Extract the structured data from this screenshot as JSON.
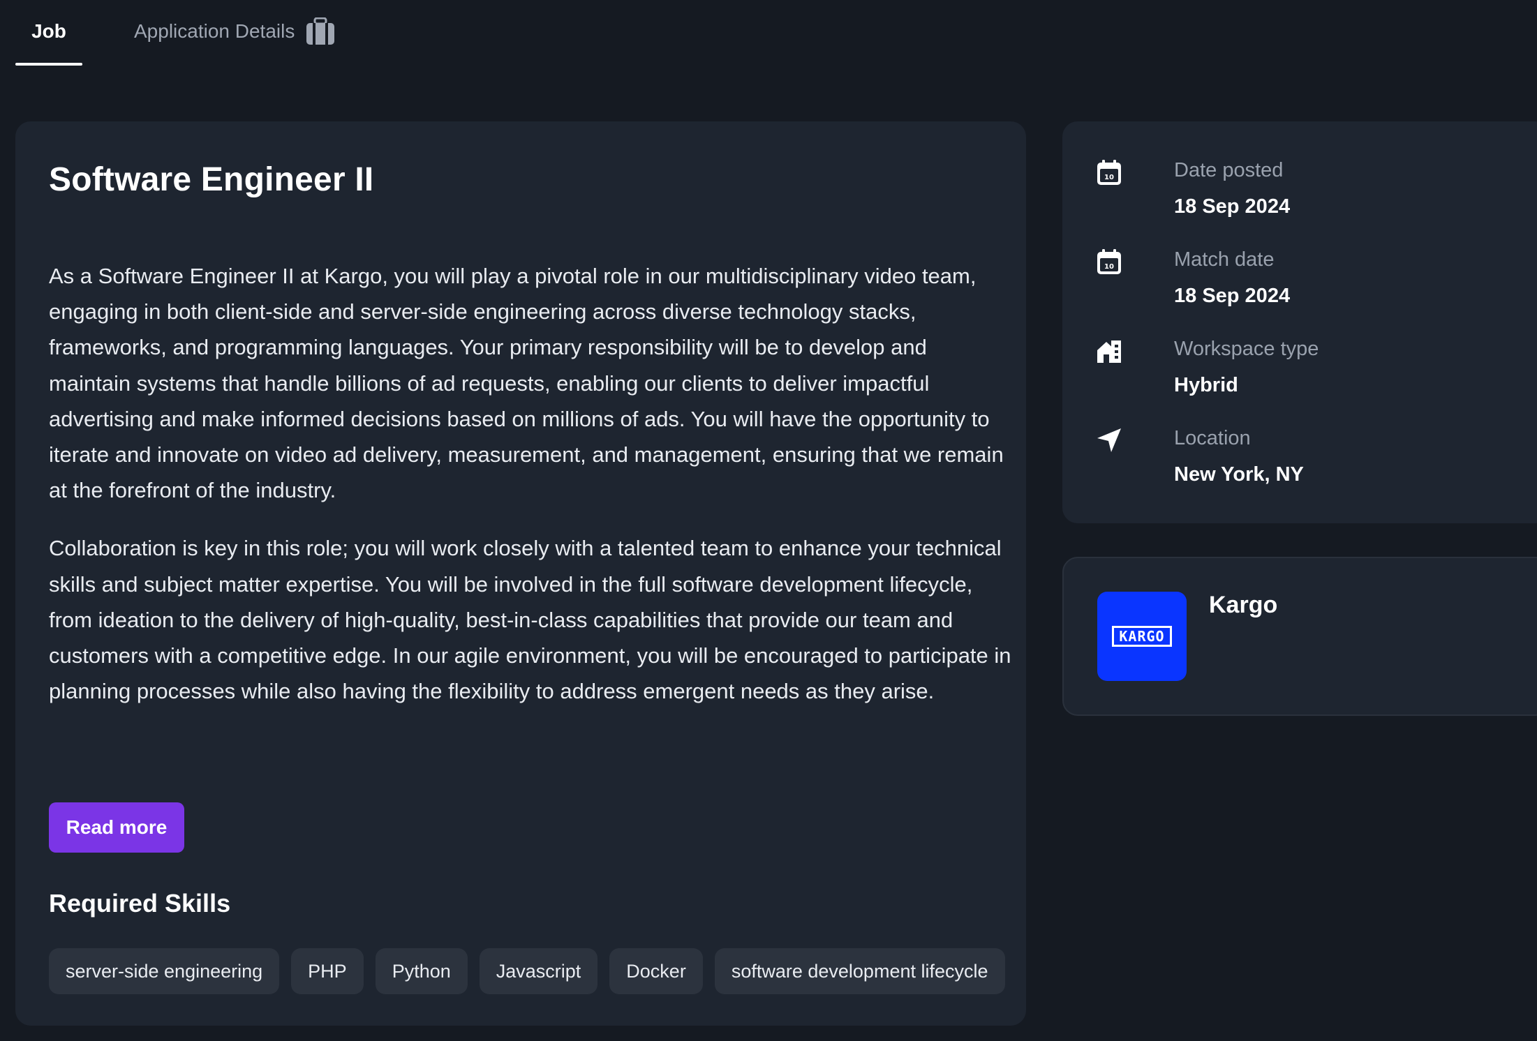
{
  "tabs": [
    {
      "label": "Job",
      "active": true
    },
    {
      "label": "Application Details",
      "icon": "briefcase-icon",
      "active": false
    }
  ],
  "job": {
    "title": "Software Engineer II",
    "description": [
      "As a Software Engineer II at Kargo, you will play a pivotal role in our multidisciplinary video team, engaging in both client-side and server-side engineering across diverse technology stacks, frameworks, and programming languages. Your primary responsibility will be to develop and maintain systems that handle billions of ad requests, enabling our clients to deliver impactful advertising and make informed decisions based on millions of ads. You will have the opportunity to iterate and innovate on video ad delivery, measurement, and management, ensuring that we remain at the forefront of the industry.",
      "Collaboration is key in this role; you will work closely with a talented team to enhance your technical skills and subject matter expertise. You will be involved in the full software development lifecycle, from ideation to the delivery of high-quality, best-in-class capabilities that provide our team and customers with a competitive edge. In our agile environment, you will be encouraged to participate in planning processes while also having the flexibility to address emergent needs as they arise."
    ],
    "read_more_label": "Read more",
    "skills_title": "Required Skills",
    "skills": [
      "server-side engineering",
      "PHP",
      "Python",
      "Javascript",
      "Docker",
      "software development lifecycle"
    ]
  },
  "info": {
    "date_posted": {
      "label": "Date posted",
      "value": "18 Sep 2024",
      "icon": "calendar-icon"
    },
    "match_date": {
      "label": "Match date",
      "value": "18 Sep 2024",
      "icon": "calendar-icon"
    },
    "workspace_type": {
      "label": "Workspace type",
      "value": "Hybrid",
      "icon": "building-icon"
    },
    "location": {
      "label": "Location",
      "value": "New York, NY",
      "icon": "location-arrow-icon"
    }
  },
  "company": {
    "name": "Kargo",
    "logo_text": "KARGO",
    "logo_color": "#0a35ff"
  },
  "colors": {
    "background": "#151a22",
    "card": "#1e2530",
    "chip": "#2c333e",
    "accent": "#7b35e6"
  }
}
